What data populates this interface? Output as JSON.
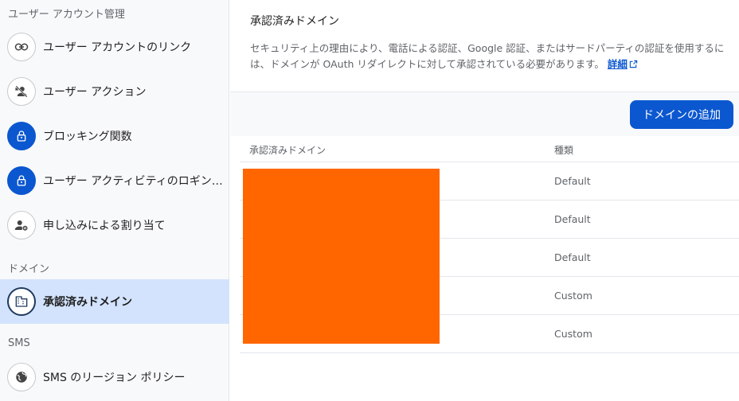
{
  "sidebar": {
    "sections": [
      {
        "title": "ユーザー アカウント管理"
      },
      {
        "title": "ドメイン"
      },
      {
        "title": "SMS"
      }
    ],
    "items": [
      {
        "label": "ユーザー アカウントのリンク",
        "icon": "link-icon"
      },
      {
        "label": "ユーザー アクション",
        "icon": "person-remove-icon"
      },
      {
        "label": "ブロッキング関数",
        "icon": "lock-icon"
      },
      {
        "label": "ユーザー アクティビティのロギン…",
        "icon": "lock-icon"
      },
      {
        "label": "申し込みによる割り当て",
        "icon": "person-gear-icon"
      },
      {
        "label": "承認済みドメイン",
        "icon": "domain-icon",
        "active": true
      },
      {
        "label": "SMS のリージョン ポリシー",
        "icon": "globe-icon"
      }
    ]
  },
  "main": {
    "title": "承認済みドメイン",
    "description": "セキュリティ上の理由により、電話による認証、Google 認証、またはサードパーティの認証を使用するには、ドメインが OAuth リダイレクトに対して承認されている必要があります。",
    "learn_more": "詳細",
    "add_button": "ドメインの追加",
    "table": {
      "headers": {
        "domain": "承認済みドメイン",
        "type": "種類"
      },
      "rows": [
        {
          "type": "Default"
        },
        {
          "type": "Default"
        },
        {
          "type": "Default"
        },
        {
          "type": "Custom"
        },
        {
          "type": "Custom"
        }
      ]
    }
  },
  "colors": {
    "accent": "#0b57d0",
    "active_bg": "#d3e3fd",
    "redaction": "#ff6600"
  }
}
